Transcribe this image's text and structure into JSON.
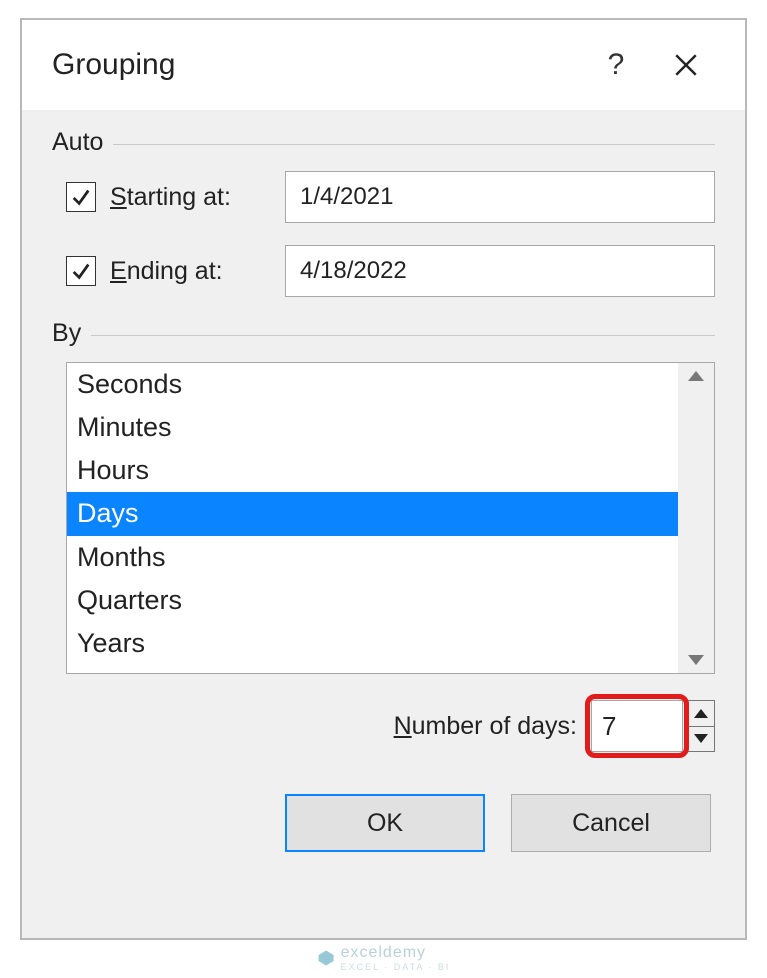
{
  "dialog": {
    "title": "Grouping"
  },
  "auto": {
    "section_label": "Auto",
    "starting_checked": true,
    "starting_label_pre": "S",
    "starting_label_post": "tarting at:",
    "starting_value": "1/4/2021",
    "ending_checked": true,
    "ending_label_pre": "E",
    "ending_label_post": "nding at:",
    "ending_value": "4/18/2022"
  },
  "by": {
    "section_label_pre": "B",
    "section_label_post": "y",
    "items": [
      "Seconds",
      "Minutes",
      "Hours",
      "Days",
      "Months",
      "Quarters",
      "Years"
    ],
    "selected_index": 3
  },
  "numdays": {
    "label_pre": "N",
    "label_post": "umber of days:",
    "value": "7"
  },
  "buttons": {
    "ok": "OK",
    "cancel": "Cancel"
  },
  "watermark": {
    "brand": "exceldemy",
    "tag": "EXCEL · DATA · BI"
  }
}
